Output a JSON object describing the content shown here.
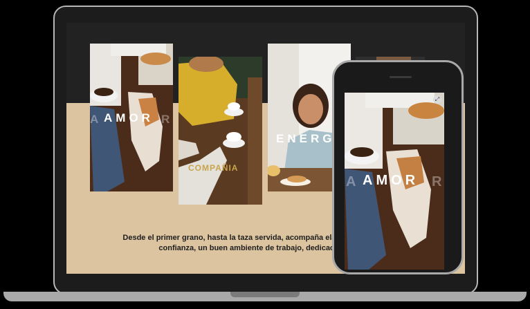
{
  "slides": [
    {
      "word": "AMOR",
      "ghost": "A",
      "ghost2": "R"
    },
    {
      "word": "COMPAÑIA"
    },
    {
      "word": "ENERGI",
      "ghost": "E"
    }
  ],
  "description": "Desde el primer grano, hasta la taza servida, acompaña elaboración con confianza, un buen ambiente de trabajo, dedicación.",
  "phone_slide": {
    "word": "AMOR",
    "ghost": "A",
    "ghost2": "R"
  },
  "icons": [
    "expand-icon",
    "coffee-cup-icon",
    "dog-icon",
    "croissant-icon"
  ],
  "colors": {
    "beige": "#dcc4a0",
    "dark": "#222222",
    "gold": "#c9a54c"
  }
}
